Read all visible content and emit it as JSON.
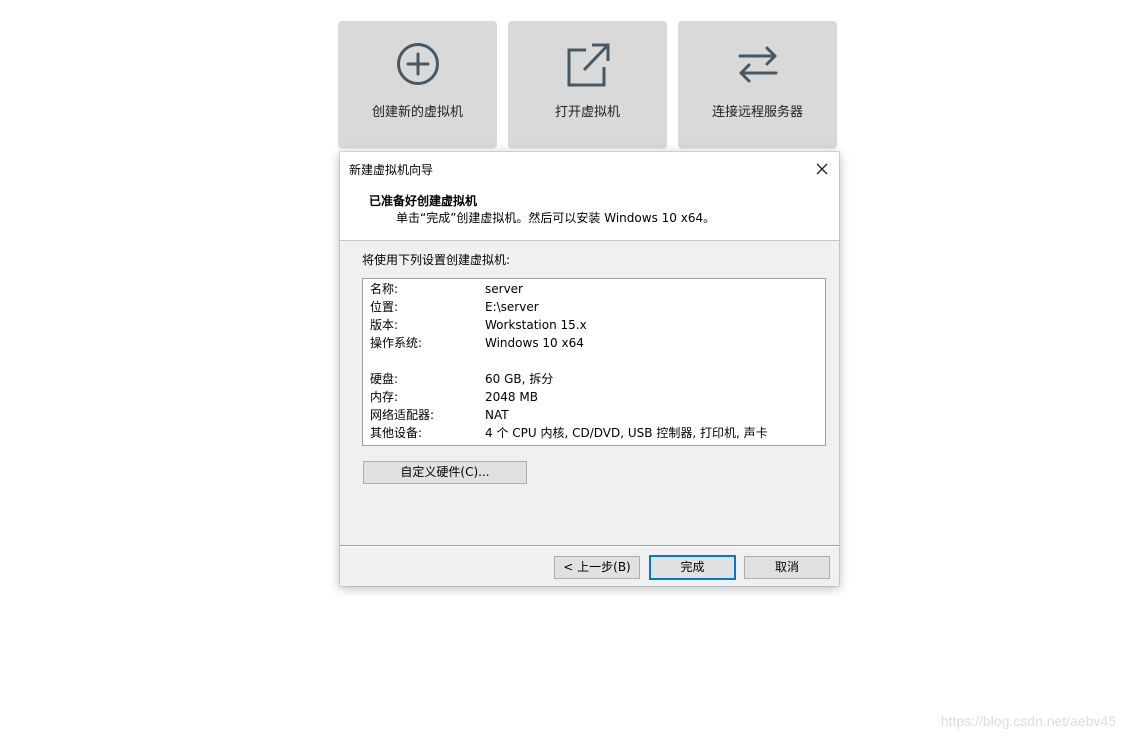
{
  "tiles": [
    {
      "label": "创建新的虚拟机",
      "icon": "plus-circle-icon"
    },
    {
      "label": "打开虚拟机",
      "icon": "external-open-icon"
    },
    {
      "label": "连接远程服务器",
      "icon": "swap-arrows-icon"
    }
  ],
  "dialog": {
    "title": "新建虚拟机向导",
    "heading": "已准备好创建虚拟机",
    "subheading": "单击“完成”创建虚拟机。然后可以安装 Windows 10 x64。",
    "intro": "将使用下列设置创建虚拟机:",
    "summary": [
      {
        "label": "名称:",
        "value": "server"
      },
      {
        "label": "位置:",
        "value": "E:\\server"
      },
      {
        "label": "版本:",
        "value": "Workstation 15.x"
      },
      {
        "label": "操作系统:",
        "value": "Windows 10 x64"
      },
      {
        "label": "硬盘:",
        "value": "60 GB, 拆分"
      },
      {
        "label": "内存:",
        "value": "2048 MB"
      },
      {
        "label": "网络适配器:",
        "value": "NAT"
      },
      {
        "label": "其他设备:",
        "value": "4 个 CPU 内核, CD/DVD, USB 控制器, 打印机, 声卡"
      }
    ],
    "customize_button": "自定义硬件(C)...",
    "back_button": "< 上一步(B)",
    "finish_button": "完成",
    "cancel_button": "取消"
  },
  "watermark": "https://blog.csdn.net/aebv45",
  "colors": {
    "tile_bg": "#d9d9d9",
    "icon_color": "#465866",
    "dialog_bg": "#f0f0f0",
    "focus_border": "#0078d7"
  }
}
